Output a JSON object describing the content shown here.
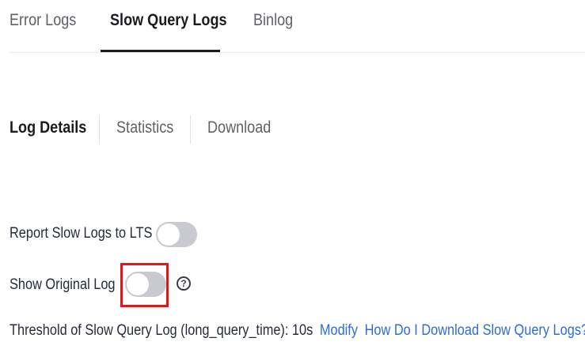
{
  "top_tabs": [
    {
      "label": "Error Logs",
      "active": false
    },
    {
      "label": "Slow Query Logs",
      "active": true
    },
    {
      "label": "Binlog",
      "active": false
    }
  ],
  "sub_tabs": [
    {
      "label": "Log Details",
      "active": true
    },
    {
      "label": "Statistics",
      "active": false
    },
    {
      "label": "Download",
      "active": false
    }
  ],
  "settings": {
    "report_lts": {
      "label": "Report Slow Logs to LTS",
      "enabled": false
    },
    "show_original": {
      "label": "Show Original Log",
      "enabled": false,
      "highlighted": true,
      "help_icon": "question-circle-icon",
      "help_glyph": "?"
    }
  },
  "threshold": {
    "text": "Threshold of Slow Query Log (long_query_time): 10s",
    "modify_link": "Modify",
    "download_help_link": "How Do I Download Slow Query Logs?"
  },
  "colors": {
    "link": "#2f6bd8",
    "highlight": "#e0161d",
    "toggle_off": "#c8cacf"
  }
}
